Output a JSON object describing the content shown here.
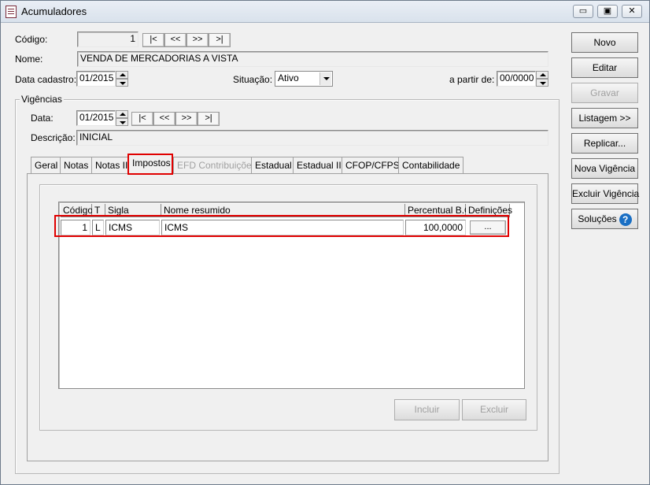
{
  "window": {
    "title": "Acumuladores",
    "minimize": "▭",
    "restore": "▣",
    "close": "✕"
  },
  "header": {
    "codigo_label": "Código:",
    "codigo_value": "1",
    "nav": [
      "|<",
      "<<",
      ">>",
      ">|"
    ],
    "nome_label": "Nome:",
    "nome_value": "VENDA DE MERCADORIAS A VISTA",
    "data_cadastro_label": "Data cadastro:",
    "data_cadastro_value": "01/2015",
    "situacao_label": "Situação:",
    "situacao_value": "Ativo",
    "a_partir_label": "a partir de:",
    "a_partir_value": "00/0000"
  },
  "vigencias": {
    "title": "Vigências",
    "data_label": "Data:",
    "data_value": "01/2015",
    "nav": [
      "|<",
      "<<",
      ">>",
      ">|"
    ],
    "descricao_label": "Descrição:",
    "descricao_value": "INICIAL"
  },
  "tabs": [
    "Geral",
    "Notas",
    "Notas II",
    "Impostos",
    "EFD Contribuições",
    "Estadual",
    "Estadual II",
    "CFOP/CFPS",
    "Contabilidade"
  ],
  "grid": {
    "headers": [
      "Código",
      "T",
      "Sigla",
      "Nome resumido",
      "Percentual B.C.",
      "Definições"
    ],
    "rows": [
      {
        "codigo": "1",
        "t": "L",
        "sigla": "ICMS",
        "nome": "ICMS",
        "percentual": "100,0000",
        "definicoes": "..."
      }
    ]
  },
  "panel_buttons": {
    "incluir": "Incluir",
    "excluir": "Excluir"
  },
  "side_buttons": {
    "novo": "Novo",
    "editar": "Editar",
    "gravar": "Gravar",
    "listagem": "Listagem >>",
    "replicar": "Replicar...",
    "nova_vigencia": "Nova Vigência",
    "excluir_vigencia": "Excluir Vigência",
    "solucoes": "Soluções"
  },
  "colors": {
    "highlight": "#e00000",
    "help_icon": "#1a6fc4"
  }
}
